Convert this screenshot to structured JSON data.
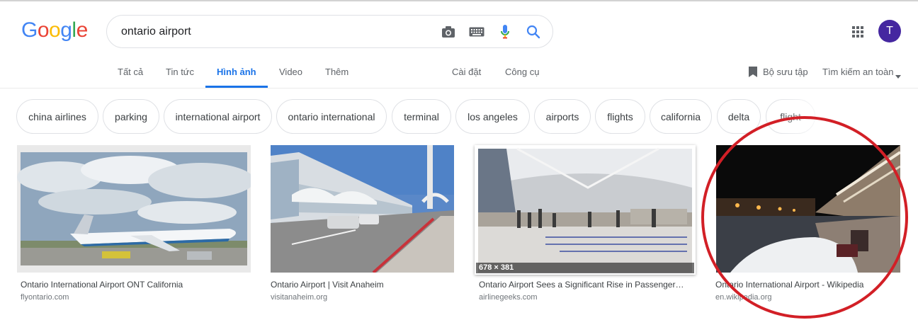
{
  "logo": {
    "letters": [
      "G",
      "o",
      "o",
      "g",
      "l",
      "e"
    ],
    "colors": [
      "#4285f4",
      "#ea4335",
      "#fbbc05",
      "#4285f4",
      "#34a853",
      "#ea4335"
    ]
  },
  "search": {
    "query": "ontario airport"
  },
  "icons": {
    "camera": "camera-icon",
    "keyboard": "keyboard-icon",
    "mic": "mic-icon",
    "search": "search-icon",
    "apps": "apps-grid-icon",
    "bookmark": "bookmark-icon",
    "caret": "caret-down-icon"
  },
  "account": {
    "initial": "T",
    "color": "#4527a0"
  },
  "tabs": [
    {
      "label": "Tất cả"
    },
    {
      "label": "Tin tức"
    },
    {
      "label": "Hình ảnh",
      "active": true
    },
    {
      "label": "Video"
    },
    {
      "label": "Thêm"
    }
  ],
  "tools": {
    "settings": "Cài đặt",
    "tools": "Công cụ"
  },
  "right_links": {
    "collections": "Bộ sưu tập",
    "safe_search": "Tìm kiếm an toàn"
  },
  "chips": [
    "china airlines",
    "parking",
    "international airport",
    "ontario international",
    "terminal",
    "los angeles",
    "airports",
    "flights",
    "california",
    "delta",
    "flight"
  ],
  "results": [
    {
      "title": "Ontario International Airport ONT California",
      "site": "flyontario.com"
    },
    {
      "title": "Ontario Airport | Visit Anaheim",
      "site": "visitanaheim.org"
    },
    {
      "title": "Ontario Airport Sees a Significant Rise in Passenger…",
      "site": "airlinegeeks.com",
      "dimensions": "678 × 381"
    },
    {
      "title": "Ontario International Airport - Wikipedia",
      "site": "en.wikipedia.org"
    }
  ],
  "annotation": {
    "ring_color": "#d21f26"
  }
}
